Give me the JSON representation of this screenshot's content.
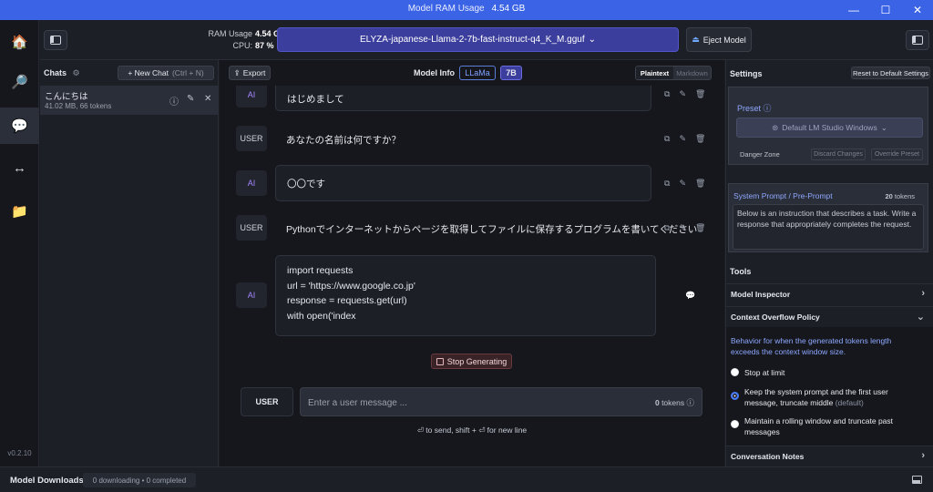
{
  "window": {
    "title": "Model RAM Usage",
    "ram_value": "4.54 GB"
  },
  "rail": {
    "version": "v0.2.10"
  },
  "topbar": {
    "ram_label": "RAM Usage",
    "ram_value": "4.54 GB",
    "cpu_label": "CPU:",
    "cpu_value": "87 %",
    "model_name": "ELYZA-japanese-Llama-2-7b-fast-instruct-q4_K_M.gguf",
    "eject_label": "Eject Model"
  },
  "chats": {
    "header": "Chats",
    "new_chat_label": "+ New Chat",
    "new_chat_shortcut": "(Ctrl + N)",
    "items": [
      {
        "title": "こんにちは",
        "subtitle": "41.02 MB, 66 tokens"
      }
    ]
  },
  "main": {
    "export_label": "Export",
    "model_info_label": "Model Info",
    "tag_arch": "LLaMa",
    "tag_size": "7B",
    "view_plaintext": "Plaintext",
    "view_markdown": "Markdown",
    "messages": [
      {
        "role": "AI",
        "text": "はじめまして"
      },
      {
        "role": "USER",
        "text": "あなたの名前は何ですか？"
      },
      {
        "role": "AI",
        "text": "〇〇です"
      },
      {
        "role": "USER",
        "text": "Pythonでインターネットからページを取得してファイルに保存するプログラムを書いてください"
      },
      {
        "role": "AI",
        "lines": [
          "import requests",
          "url = 'https://www.google.co.jp'",
          "response = requests.get(url)",
          "with open('index"
        ]
      }
    ],
    "stop_label": "Stop Generating",
    "input_role": "USER",
    "input_placeholder": "Enter a user message ...",
    "token_count": "0",
    "token_label": "tokens",
    "hint": "⏎ to send, shift + ⏎ for new line"
  },
  "settings": {
    "title": "Settings",
    "reset_label": "Reset to Default Settings",
    "preset_label": "Preset",
    "preset_value": "Default LM Studio Windows",
    "danger_zone": "Danger Zone",
    "discard_label": "Discard Changes",
    "override_label": "Override Preset",
    "system_prompt_label": "System Prompt / Pre-Prompt",
    "system_prompt_tokens": "20",
    "system_prompt_tokens_label": "tokens",
    "system_prompt_text": "Below is an instruction that describes a task. Write a response that appropriately completes the request.",
    "tools_label": "Tools",
    "model_inspector": "Model Inspector",
    "context_overflow": "Context Overflow Policy",
    "overflow_desc": "Behavior for when the generated tokens length exceeds the context window size.",
    "options": [
      {
        "label": "Stop at limit",
        "selected": false
      },
      {
        "label": "Keep the system prompt and the first user message, truncate middle",
        "extra": "(default)",
        "selected": true
      },
      {
        "label": "Maintain a rolling window and truncate past messages",
        "selected": false
      }
    ],
    "conversation_notes": "Conversation Notes"
  },
  "bottom": {
    "downloads_label": "Model Downloads",
    "downloads_status": "0 downloading • 0 completed"
  },
  "colors": {
    "accent": "#3b3e9c",
    "titlebar": "#3a63e6",
    "link": "#8ea8ff"
  }
}
